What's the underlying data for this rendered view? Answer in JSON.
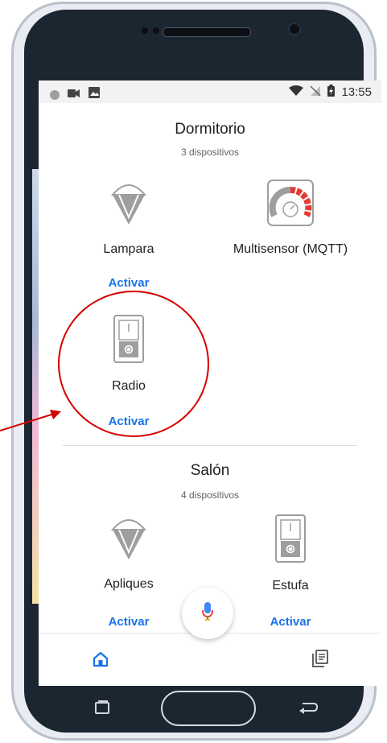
{
  "status_bar": {
    "time": "13:55"
  },
  "sections": [
    {
      "title": "Dormitorio",
      "subtitle": "3 dispositivos",
      "devices": [
        {
          "name": "Lampara",
          "icon": "lamp-icon",
          "action": "Activar"
        },
        {
          "name": "Multisensor (MQTT)",
          "icon": "gauge-sensor-icon",
          "action": ""
        },
        {
          "name": "Radio",
          "icon": "switch-device-icon",
          "action": "Activar"
        }
      ]
    },
    {
      "title": "Salón",
      "subtitle": "4 dispositivos",
      "devices": [
        {
          "name": "Apliques",
          "icon": "lamp-icon",
          "action": "Activar"
        },
        {
          "name": "Estufa",
          "icon": "switch-device-icon",
          "action": "Activar"
        }
      ]
    }
  ],
  "bottom_nav": {
    "home_icon": "home-icon",
    "feed_icon": "list-icon",
    "mic_icon": "mic-icon"
  },
  "colors": {
    "accent": "#1a73e8",
    "annotation": "#d40000",
    "gauge_red": "#e53935"
  }
}
